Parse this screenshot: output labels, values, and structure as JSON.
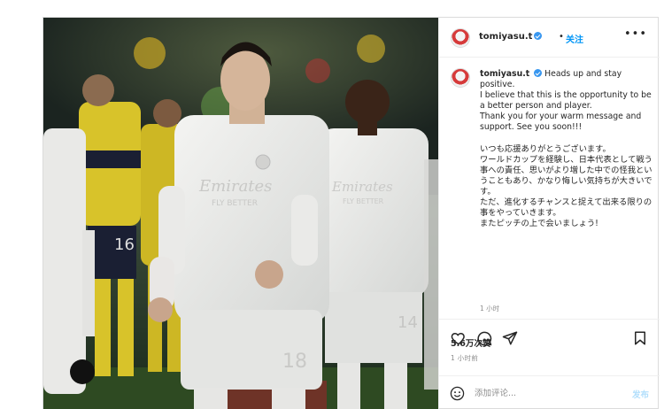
{
  "user": {
    "username": "tomiyasu.t",
    "follow_label": "关注",
    "separator": "•",
    "more_label": "•••"
  },
  "caption": {
    "username": "tomiyasu.t",
    "lines_en": [
      "Heads up and stay positive.",
      "I believe that this is the opportunity to be a better person and player.",
      "Thank you for your warm message and support. See you soon!!!"
    ],
    "lines_jp": [
      "いつも応援ありがとうございます。",
      "ワールドカップを経験し、日本代表として戦う事への責任、思いがより増した中での怪我ということもあり、かなり悔しい気持ちが大きいです。",
      "ただ、進化するチャンスと捉えて出来る限りの事をやっていきます。",
      "またピッチの上で会いましょう!"
    ],
    "time": "1 小时"
  },
  "stats": {
    "likes": "5.6万次赞",
    "time": "1 小时前"
  },
  "comment": {
    "placeholder": "添加评论...",
    "post_label": "发布"
  },
  "photo": {
    "shirt_sponsor": "Emirates",
    "shirt_tagline": "FLY BETTER",
    "number_left": "18",
    "number_right": "14",
    "number_bg": "16"
  },
  "colors": {
    "accent": "#0095f6",
    "verified": "#3897f0",
    "muted": "#8e8e8e",
    "border": "#dbdbdb"
  }
}
